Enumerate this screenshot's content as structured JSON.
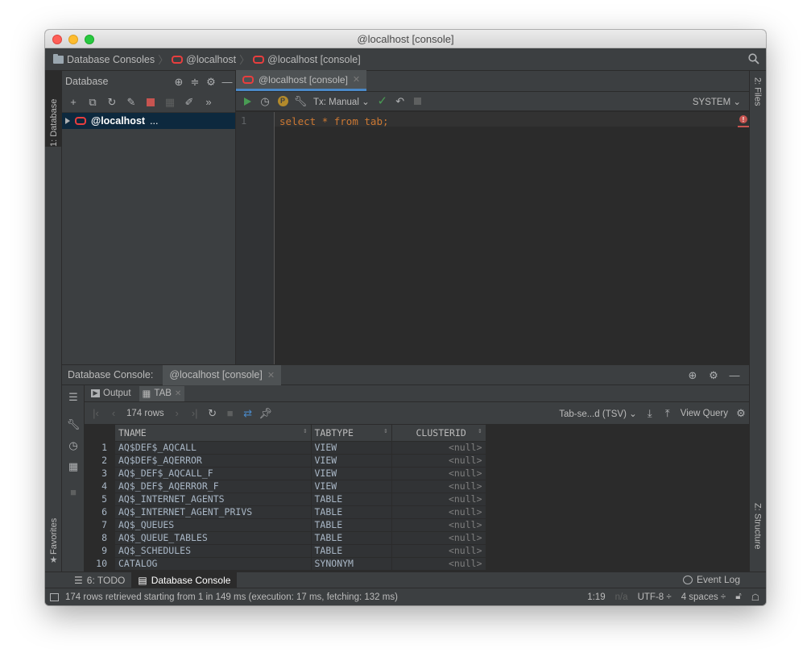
{
  "window": {
    "title": "@localhost [console]"
  },
  "navbar": {
    "crumbs": [
      "Database Consoles",
      "@localhost",
      "@localhost [console]"
    ]
  },
  "left_strip": {
    "database_tab": "1: Database",
    "favorites_tab": "Favorites"
  },
  "right_strip": {
    "files_tab": "2: Files",
    "structure_tab": "Z: Structure"
  },
  "db_panel": {
    "title": "Database",
    "tree": [
      {
        "label": "@localhost",
        "suffix": "..."
      }
    ]
  },
  "editor": {
    "tab_label": "@localhost [console]",
    "tx_mode": "Tx: Manual",
    "schema": "SYSTEM",
    "line_numbers": [
      "1"
    ],
    "code": {
      "kw1": "select",
      "star": "*",
      "kw2": "from",
      "table": "tab",
      "end": ";"
    }
  },
  "bottom_panel": {
    "title": "Database Console:",
    "tab_label": "@localhost [console]",
    "subtabs": {
      "output": "Output",
      "result": "TAB"
    },
    "rows_count": "174 rows",
    "export_format": "Tab-se...d (TSV)",
    "view_query": "View Query",
    "columns": [
      "TNAME",
      "TABTYPE",
      "CLUSTERID"
    ],
    "rows": [
      {
        "n": "1",
        "tname": "AQ$DEF$_AQCALL",
        "tabtype": "VIEW",
        "clusterid": "<null>"
      },
      {
        "n": "2",
        "tname": "AQ$DEF$_AQERROR",
        "tabtype": "VIEW",
        "clusterid": "<null>"
      },
      {
        "n": "3",
        "tname": "AQ$_DEF$_AQCALL_F",
        "tabtype": "VIEW",
        "clusterid": "<null>"
      },
      {
        "n": "4",
        "tname": "AQ$_DEF$_AQERROR_F",
        "tabtype": "VIEW",
        "clusterid": "<null>"
      },
      {
        "n": "5",
        "tname": "AQ$_INTERNET_AGENTS",
        "tabtype": "TABLE",
        "clusterid": "<null>"
      },
      {
        "n": "6",
        "tname": "AQ$_INTERNET_AGENT_PRIVS",
        "tabtype": "TABLE",
        "clusterid": "<null>"
      },
      {
        "n": "7",
        "tname": "AQ$_QUEUES",
        "tabtype": "TABLE",
        "clusterid": "<null>"
      },
      {
        "n": "8",
        "tname": "AQ$_QUEUE_TABLES",
        "tabtype": "TABLE",
        "clusterid": "<null>"
      },
      {
        "n": "9",
        "tname": "AQ$_SCHEDULES",
        "tabtype": "TABLE",
        "clusterid": "<null>"
      },
      {
        "n": "10",
        "tname": "CATALOG",
        "tabtype": "SYNONYM",
        "clusterid": "<null>"
      }
    ]
  },
  "tool_windows": {
    "todo": "6: TODO",
    "db_console": "Database Console",
    "event_log": "Event Log"
  },
  "status": {
    "message": "174 rows retrieved starting from 1 in 149 ms (execution: 17 ms, fetching: 132 ms)",
    "position": "1:19",
    "line_sep": "n/a",
    "encoding": "UTF-8 ÷",
    "indent": "4 spaces ÷"
  },
  "colors": {
    "accent": "#4a88c7",
    "oracle_red": "#e83e3e",
    "run_green": "#499c54",
    "bg": "#3c3f41",
    "editor_bg": "#2b2b2b"
  }
}
